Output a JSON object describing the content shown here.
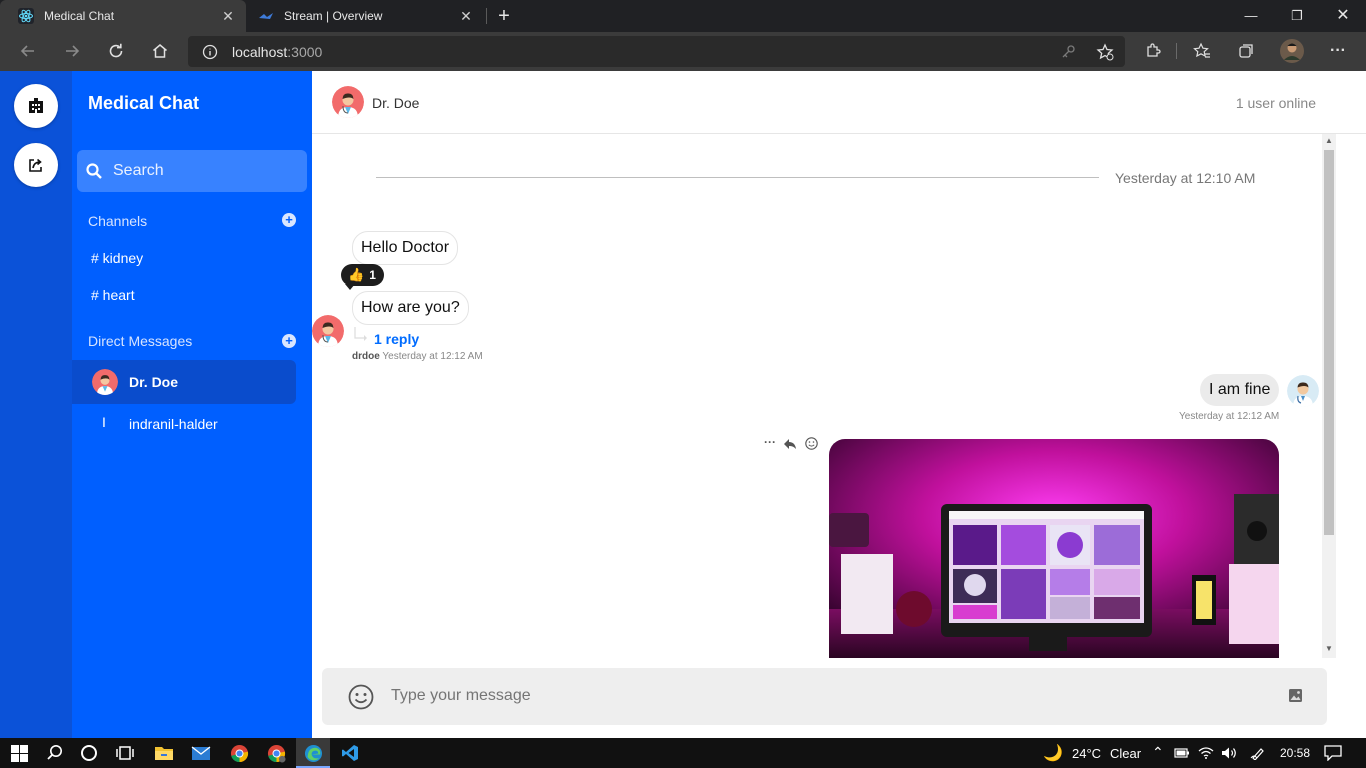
{
  "browser": {
    "tabs": [
      {
        "title": "Medical Chat",
        "active": true
      },
      {
        "title": "Stream | Overview",
        "active": false
      }
    ],
    "address": {
      "host": "localhost",
      "port": ":3000"
    }
  },
  "app": {
    "brand": "Medical Chat",
    "search_placeholder": "Search",
    "channels_label": "Channels",
    "channels": [
      "# kidney",
      "# heart"
    ],
    "dm_label": "Direct Messages",
    "dms": [
      {
        "name": "Dr. Doe",
        "initial": "",
        "active": true
      },
      {
        "name": "indranil-halder",
        "initial": "I",
        "active": false
      }
    ]
  },
  "chat": {
    "header_name": "Dr. Doe",
    "online": "1 user online",
    "date_separator": "Yesterday at 12:10 AM",
    "messages": {
      "m1": "Hello Doctor",
      "reaction_emoji": "👍",
      "reaction_count": "1",
      "m2": "How are you?",
      "reply": "1 reply",
      "m2_user": "drdoe",
      "m2_time": "Yesterday at 12:12 AM",
      "m3": "I am fine",
      "m3_time": "Yesterday at 12:12 AM"
    },
    "composer_placeholder": "Type your message"
  },
  "taskbar": {
    "weather": "24°C",
    "condition": "Clear",
    "time": "20:58"
  },
  "colors": {
    "sidebar": "#005fff",
    "rail": "#0b52d8",
    "accent": "#006cff"
  }
}
